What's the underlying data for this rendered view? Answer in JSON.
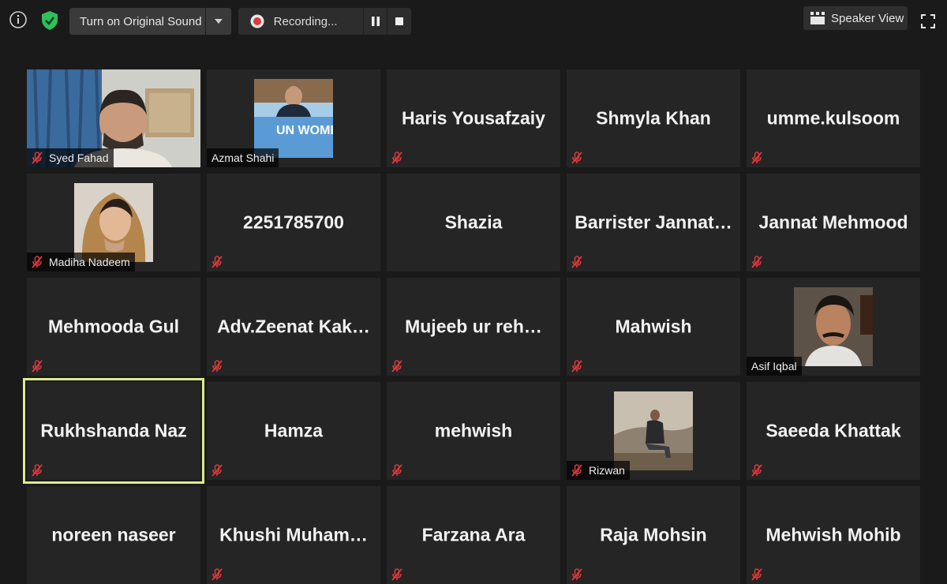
{
  "toolbar": {
    "info_icon": "info-icon",
    "shield_icon": "shield-icon",
    "original_sound_label": "Turn on Original Sound",
    "recording_label": "Recording...",
    "speaker_view_label": "Speaker View",
    "fullscreen_icon": "fullscreen-icon"
  },
  "colors": {
    "background": "#1a1a1a",
    "tile": "#252525",
    "active_border": "#d9ec8a",
    "mute_icon": "#e0383b",
    "shield": "#2fbf5c"
  },
  "participants": [
    {
      "name": "Syed Fahad",
      "video": true
    },
    {
      "name": "Azmat Shahi",
      "video": true,
      "photo_text": "UN WOMEN"
    },
    {
      "name": "Haris Yousafzaiy",
      "video": false
    },
    {
      "name": "Shmyla Khan",
      "video": false
    },
    {
      "name": "umme.kulsoom",
      "video": false
    },
    {
      "name": "Madiha Nadeem",
      "video": true
    },
    {
      "name": "2251785700",
      "video": false
    },
    {
      "name": "Shazia",
      "video": false
    },
    {
      "name": "Barrister  Jannat…",
      "video": false
    },
    {
      "name": "Jannat Mehmood",
      "video": false
    },
    {
      "name": "Mehmooda Gul",
      "video": false
    },
    {
      "name": "Adv.Zeenat  Kak…",
      "video": false
    },
    {
      "name": "Mujeeb  ur  reh…",
      "video": false
    },
    {
      "name": "Mahwish",
      "video": false
    },
    {
      "name": "Asif Iqbal",
      "video": true
    },
    {
      "name": "Rukhshanda Naz",
      "video": false,
      "active_speaker": true
    },
    {
      "name": "Hamza",
      "video": false
    },
    {
      "name": "mehwish",
      "video": false
    },
    {
      "name": "Rizwan",
      "video": true
    },
    {
      "name": "Saeeda Khattak",
      "video": false
    },
    {
      "name": "noreen naseer",
      "video": false
    },
    {
      "name": "Khushi  Muham…",
      "video": false
    },
    {
      "name": "Farzana Ara",
      "video": false
    },
    {
      "name": "Raja Mohsin",
      "video": false
    },
    {
      "name": "Mehwish Mohib",
      "video": false
    }
  ]
}
